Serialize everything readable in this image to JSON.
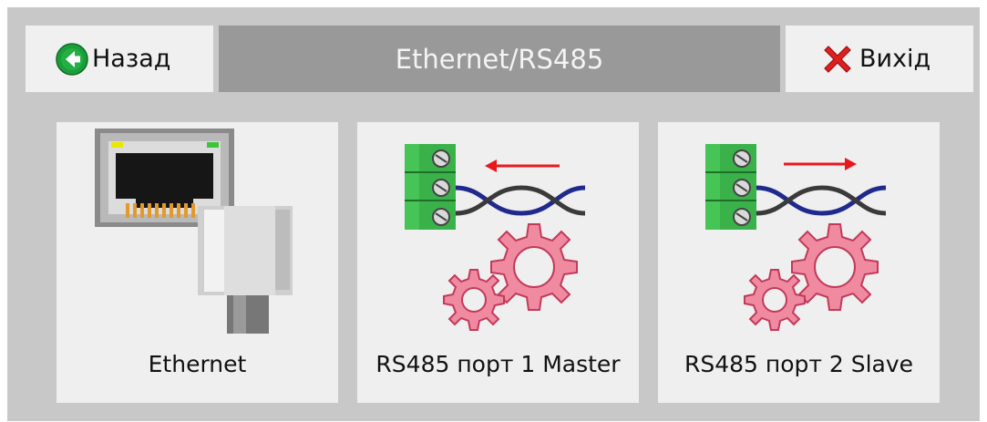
{
  "header": {
    "back_label": "Назад",
    "title": "Ethernet/RS485",
    "exit_label": "Вихід"
  },
  "tiles": [
    {
      "label": "Ethernet",
      "icon": "ethernet-port-icon"
    },
    {
      "label": "RS485 порт 1 Master",
      "icon": "rs485-master-icon"
    },
    {
      "label": "RS485 порт 2 Slave",
      "icon": "rs485-slave-icon"
    }
  ],
  "colors": {
    "frame": "#c8c8c8",
    "button": "#f0f0f0",
    "title_bar": "#999999",
    "title_text": "#f4f4f4",
    "tile": "#efefef",
    "back_icon": "#1a9e3a",
    "exit_icon": "#e02020",
    "terminal_green": "#3bb14a",
    "arrow_red": "#e8191c",
    "gear_pink": "#f08aa0"
  }
}
